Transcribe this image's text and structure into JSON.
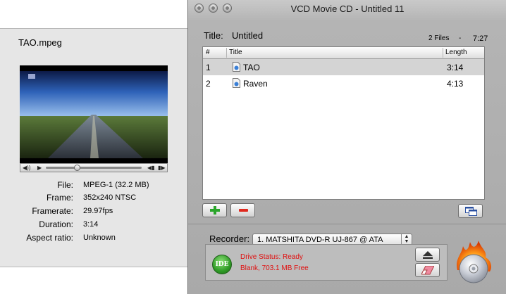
{
  "inspector": {
    "filename": "TAO.mpeg",
    "player": {
      "progress": 0.32
    },
    "info": [
      {
        "label": "File:",
        "value": "MPEG-1 (32.2 MB)"
      },
      {
        "label": "Frame:",
        "value": "352x240 NTSC"
      },
      {
        "label": "Framerate:",
        "value": "29.97fps"
      },
      {
        "label": "Duration:",
        "value": "3:14"
      },
      {
        "label": "Aspect ratio:",
        "value": "Unknown"
      }
    ]
  },
  "window": {
    "title": "VCD Movie CD - Untitled 11",
    "disc_title_label": "Title:",
    "disc_title": "Untitled",
    "files_count": "2 Files",
    "files_sep": "-",
    "total_length": "7:27",
    "columns": {
      "num": "#",
      "title": "Title",
      "length": "Length"
    },
    "rows": [
      {
        "num": "1",
        "title": "TAO",
        "length": "3:14",
        "selected": true
      },
      {
        "num": "2",
        "title": "Raven",
        "length": "4:13",
        "selected": false
      }
    ],
    "recorder_label": "Recorder:",
    "recorder_value": "1. MATSHITA DVD-R   UJ-867 @ ATA",
    "drive_badge": "IDE",
    "status_line1": "Drive Status: Ready",
    "status_line2": "Blank, 703.1 MB Free",
    "status_color": "#e01010"
  }
}
